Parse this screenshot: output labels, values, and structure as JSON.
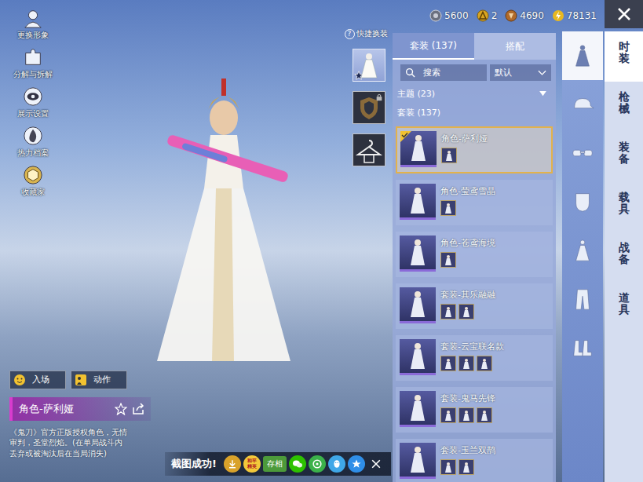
{
  "currencies": [
    {
      "value": "5600",
      "kind": "silver"
    },
    {
      "value": "2",
      "kind": "gold"
    },
    {
      "value": "4690",
      "kind": "bronze"
    },
    {
      "value": "78131",
      "kind": "energy"
    }
  ],
  "left_menu": [
    {
      "label": "更换形象",
      "kind": "avatar"
    },
    {
      "label": "分解与拆解",
      "kind": "puzzle"
    },
    {
      "label": "展示设置",
      "kind": "eye"
    },
    {
      "label": "热力档案",
      "kind": "flame"
    },
    {
      "label": "收藏家",
      "kind": "badge"
    }
  ],
  "quick_change": {
    "label": "快捷换装",
    "help": "?",
    "slots": [
      {
        "kind": "outfit",
        "starred": true,
        "locked": false
      },
      {
        "kind": "emblem",
        "starred": false,
        "locked": true
      },
      {
        "kind": "hanger",
        "starred": false,
        "locked": false
      }
    ]
  },
  "list_panel": {
    "tabs": [
      {
        "label": "套装 (137)",
        "selected": true
      },
      {
        "label": "搭配",
        "selected": false
      }
    ],
    "search": {
      "placeholder": "搜索"
    },
    "sort": {
      "value": "默认"
    },
    "theme_group": {
      "label": "主题 (23)",
      "expanded": false
    },
    "section": "套装 (137)",
    "items": [
      {
        "name": "角色-萨利娅",
        "selected": true,
        "equipped": true,
        "parts": 1
      },
      {
        "name": "角色-莹鸢雪晶",
        "selected": false,
        "equipped": false,
        "parts": 1
      },
      {
        "name": "角色-苍鸢海境",
        "selected": false,
        "equipped": false,
        "parts": 1
      },
      {
        "name": "套装-其乐融融",
        "selected": false,
        "equipped": false,
        "parts": 2
      },
      {
        "name": "套装-云宝联名款",
        "selected": false,
        "equipped": false,
        "parts": 3
      },
      {
        "name": "套装-鬼马先锋",
        "selected": false,
        "equipped": false,
        "parts": 3
      },
      {
        "name": "套装-玉兰双鹊",
        "selected": false,
        "equipped": false,
        "parts": 2
      }
    ]
  },
  "category_icons": [
    {
      "kind": "dress",
      "selected": true
    },
    {
      "kind": "cap",
      "selected": false
    },
    {
      "kind": "glasses",
      "selected": false
    },
    {
      "kind": "mask",
      "selected": false
    },
    {
      "kind": "gown",
      "selected": false
    },
    {
      "kind": "pants",
      "selected": false
    },
    {
      "kind": "boots",
      "selected": false
    }
  ],
  "main_tabs": [
    {
      "label": "时装",
      "selected": true
    },
    {
      "label": "枪械",
      "selected": false
    },
    {
      "label": "装备",
      "selected": false
    },
    {
      "label": "载具",
      "selected": false
    },
    {
      "label": "战备",
      "selected": false
    },
    {
      "label": "道具",
      "selected": false
    }
  ],
  "actions": [
    {
      "label": "入场",
      "kind": "face"
    },
    {
      "label": "动作",
      "kind": "pose"
    }
  ],
  "selected_outfit": {
    "name": "角色-萨利娅",
    "favorited": false,
    "description": "《鬼刀》官方正版授权角色，无情审判，圣堂烈焰。(在单局战斗内丢弃或被淘汰后在当局消失)"
  },
  "toast": {
    "message": "截图成功!",
    "save_button": "存相",
    "share": [
      {
        "kind": "download"
      },
      {
        "kind": "game",
        "label": "和平精英"
      },
      {
        "kind": "save"
      },
      {
        "kind": "wechat"
      },
      {
        "kind": "moments"
      },
      {
        "kind": "qq"
      },
      {
        "kind": "qzone"
      },
      {
        "kind": "close"
      }
    ]
  }
}
